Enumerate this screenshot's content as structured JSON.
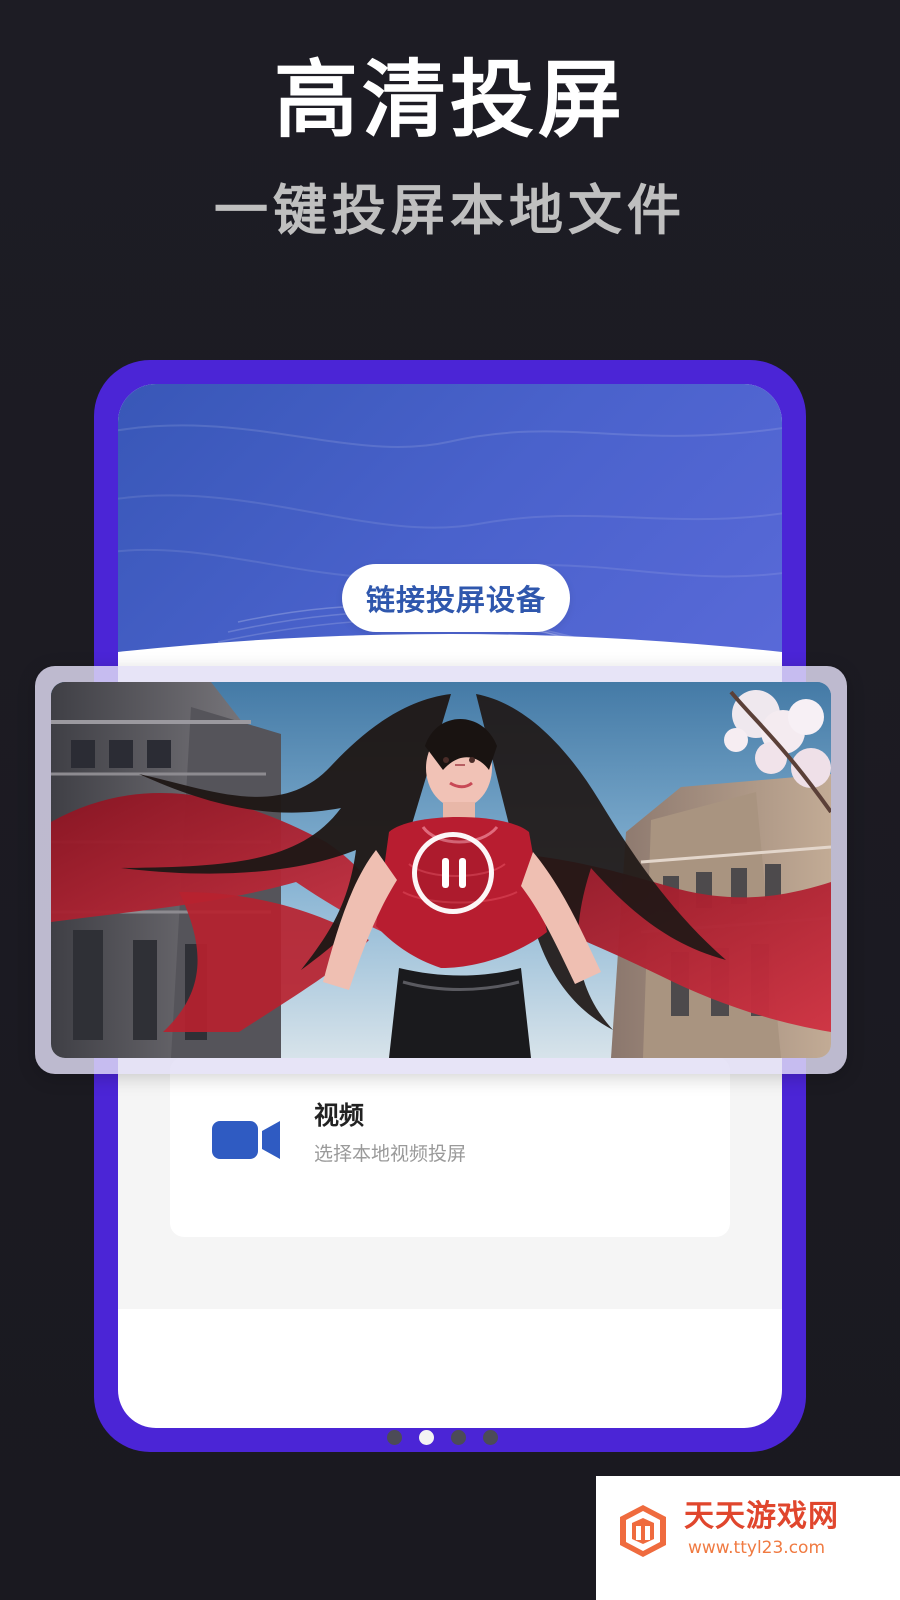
{
  "header": {
    "title": "高清投屏",
    "subtitle": "一键投屏本地文件"
  },
  "phone": {
    "connect_button": "链接投屏设备",
    "video_card": {
      "title": "视频",
      "description": "选择本地视频投屏",
      "icon": "video-camera-icon"
    }
  },
  "player": {
    "state": "paused",
    "control_icon": "pause-icon"
  },
  "pager": {
    "current_page": 2,
    "total_pages": 4
  },
  "watermark": {
    "title": "天天游戏网",
    "url": "www.ttyl23.com",
    "logo_icon": "watermark-logo-icon"
  },
  "colors": {
    "background": "#1b1a22",
    "phone_frame": "#4b25d6",
    "hero_blue": "#4a62cc",
    "video_blue": "#2f5bc2",
    "watermark_orange": "#e0462d"
  }
}
